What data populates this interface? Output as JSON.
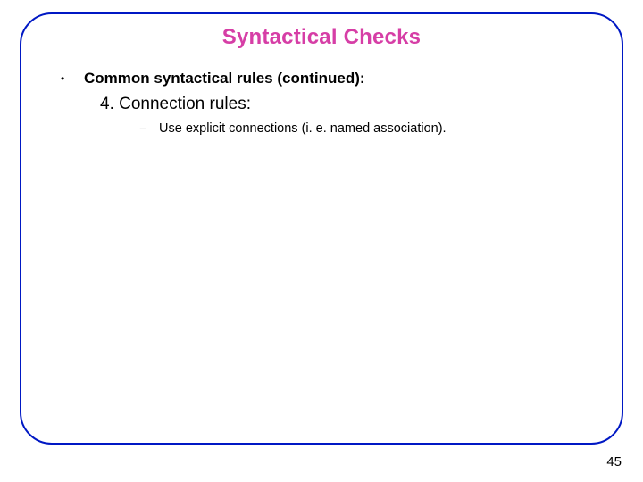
{
  "slide": {
    "title": "Syntactical Checks",
    "bullet_marker": "•",
    "bullet": "Common syntactical rules (continued):",
    "subheading": "4. Connection rules:",
    "dash_marker": "−",
    "dash_item": "Use explicit connections (i. e. named association).",
    "page_number": "45"
  }
}
